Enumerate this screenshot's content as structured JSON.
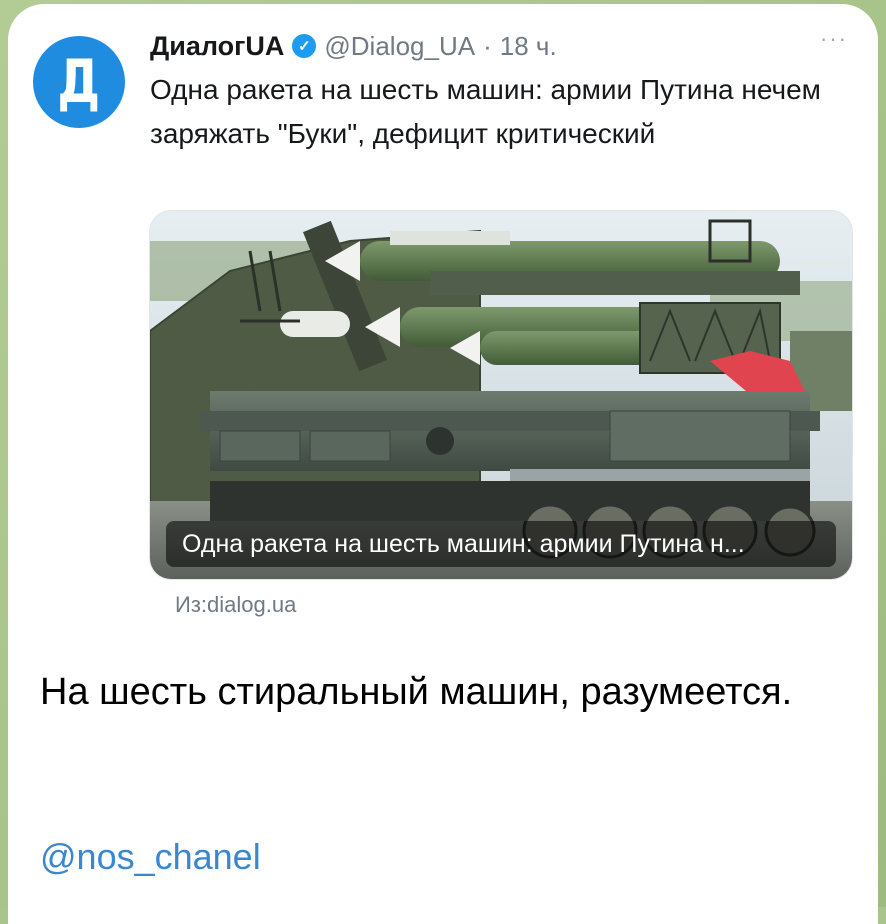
{
  "tweet": {
    "author": "ДиалогUA",
    "avatar_letter": "Д",
    "handle": "@Dialog_UA",
    "separator": "·",
    "time": "18 ч.",
    "more_label": "···",
    "verified_mark": "✓",
    "text": "Одна ракета на шесть машин: армии Путина нечем заряжать \"Буки\", дефицит критический",
    "card": {
      "caption": "Одна ракета на шесть машин: армии Путина н...",
      "source": "Из:dialog.ua"
    }
  },
  "message": {
    "text": "На шесть стиральный машин, разумеется.",
    "channel_link": "@nos_chanel"
  },
  "colors": {
    "accent": "#1d9bf0",
    "avatar": "#1f8ce0",
    "link": "#3a87cf",
    "chat_bg": "#a9c48d"
  }
}
